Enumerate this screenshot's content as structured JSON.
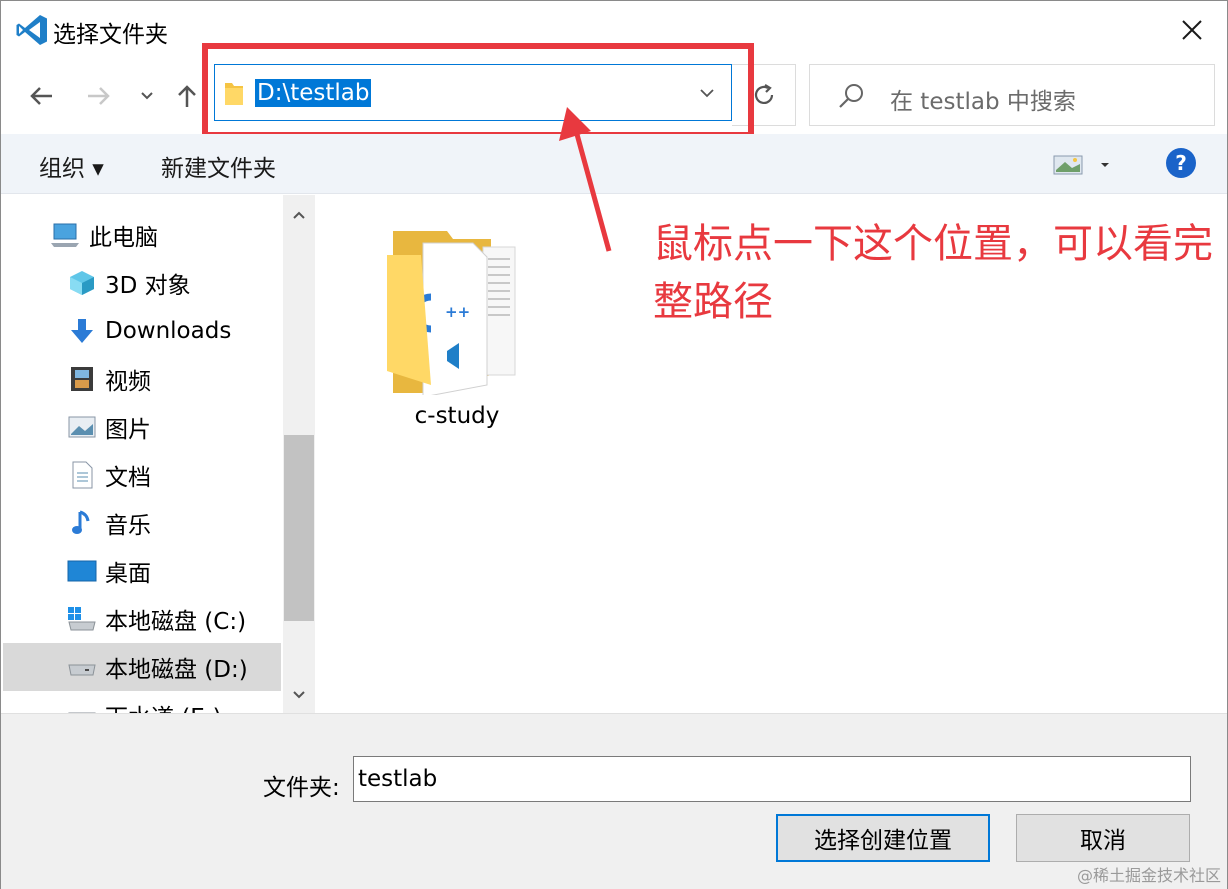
{
  "window": {
    "title": "选择文件夹"
  },
  "address_bar": {
    "path": "D:\\testlab"
  },
  "search": {
    "placeholder": "在 testlab 中搜索"
  },
  "toolbar": {
    "organize_label": "组织 ▾",
    "new_folder_label": "新建文件夹"
  },
  "nav_pane": {
    "items": [
      {
        "label": "此电脑",
        "icon": "computer-icon"
      },
      {
        "label": "3D 对象",
        "icon": "3d-objects-icon"
      },
      {
        "label": "Downloads",
        "icon": "download-icon"
      },
      {
        "label": "视频",
        "icon": "video-icon"
      },
      {
        "label": "图片",
        "icon": "pictures-icon"
      },
      {
        "label": "文档",
        "icon": "document-icon"
      },
      {
        "label": "音乐",
        "icon": "music-icon"
      },
      {
        "label": "桌面",
        "icon": "desktop-icon"
      },
      {
        "label": "本地磁盘 (C:)",
        "icon": "windows-drive-icon"
      },
      {
        "label": "本地磁盘 (D:)",
        "icon": "drive-icon",
        "selected": true
      },
      {
        "label": "下水道 (E:)",
        "icon": "drive-icon"
      }
    ]
  },
  "content": {
    "folders": [
      {
        "name": "c-study"
      }
    ]
  },
  "annotation": {
    "text": "鼠标点一下这个位置，可以看完整路径",
    "color": "#e8393f"
  },
  "footer": {
    "folder_label": "文件夹:",
    "folder_value": "testlab",
    "select_button": "选择创建位置",
    "cancel_button": "取消"
  },
  "watermark": {
    "text": "@稀土掘金技术社区"
  },
  "colors": {
    "accent": "#0078d7",
    "highlight_red": "#e8393f",
    "toolbar_bg": "#f0f4f9"
  }
}
